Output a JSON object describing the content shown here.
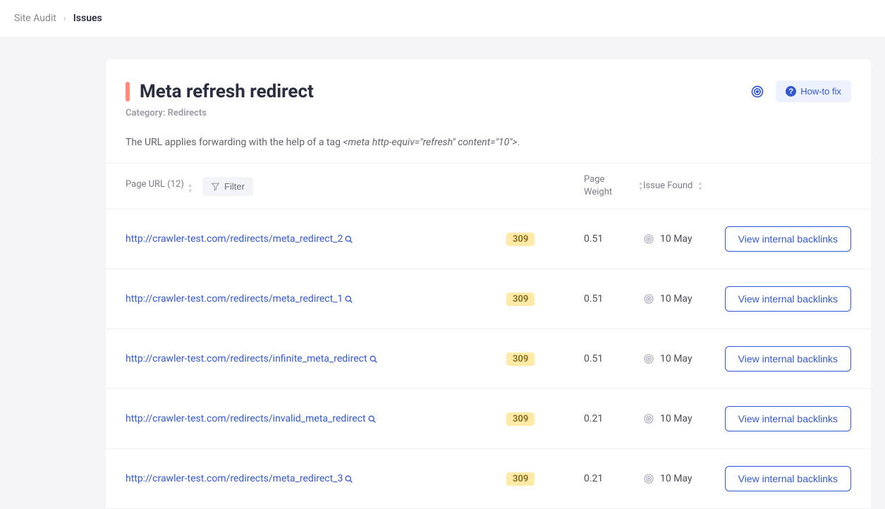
{
  "breadcrumb": {
    "parent": "Site Audit",
    "current": "Issues"
  },
  "header": {
    "title": "Meta refresh redirect",
    "category_label": "Category:",
    "category_value": "Redirects",
    "howto_label": "How-to fix",
    "description_prefix": "The URL applies forwarding with the help of a tag ",
    "description_code": "<meta http-equiv=\"refresh\" content=\"10\">",
    "description_suffix": "."
  },
  "table": {
    "columns": {
      "url_label": "Page URL (12)",
      "filter_label": "Filter",
      "weight_label": "Page Weight",
      "issue_label": "Issue Found"
    },
    "action_label": "View internal backlinks",
    "rows": [
      {
        "url": "http://crawler-test.com/redirects/meta_redirect_2",
        "code": "309",
        "weight": "0.51",
        "found": "10 May"
      },
      {
        "url": "http://crawler-test.com/redirects/meta_redirect_1",
        "code": "309",
        "weight": "0.51",
        "found": "10 May"
      },
      {
        "url": "http://crawler-test.com/redirects/infinite_meta_redirect",
        "code": "309",
        "weight": "0.51",
        "found": "10 May"
      },
      {
        "url": "http://crawler-test.com/redirects/invalid_meta_redirect",
        "code": "309",
        "weight": "0.21",
        "found": "10 May"
      },
      {
        "url": "http://crawler-test.com/redirects/meta_redirect_3",
        "code": "309",
        "weight": "0.21",
        "found": "10 May"
      }
    ]
  }
}
